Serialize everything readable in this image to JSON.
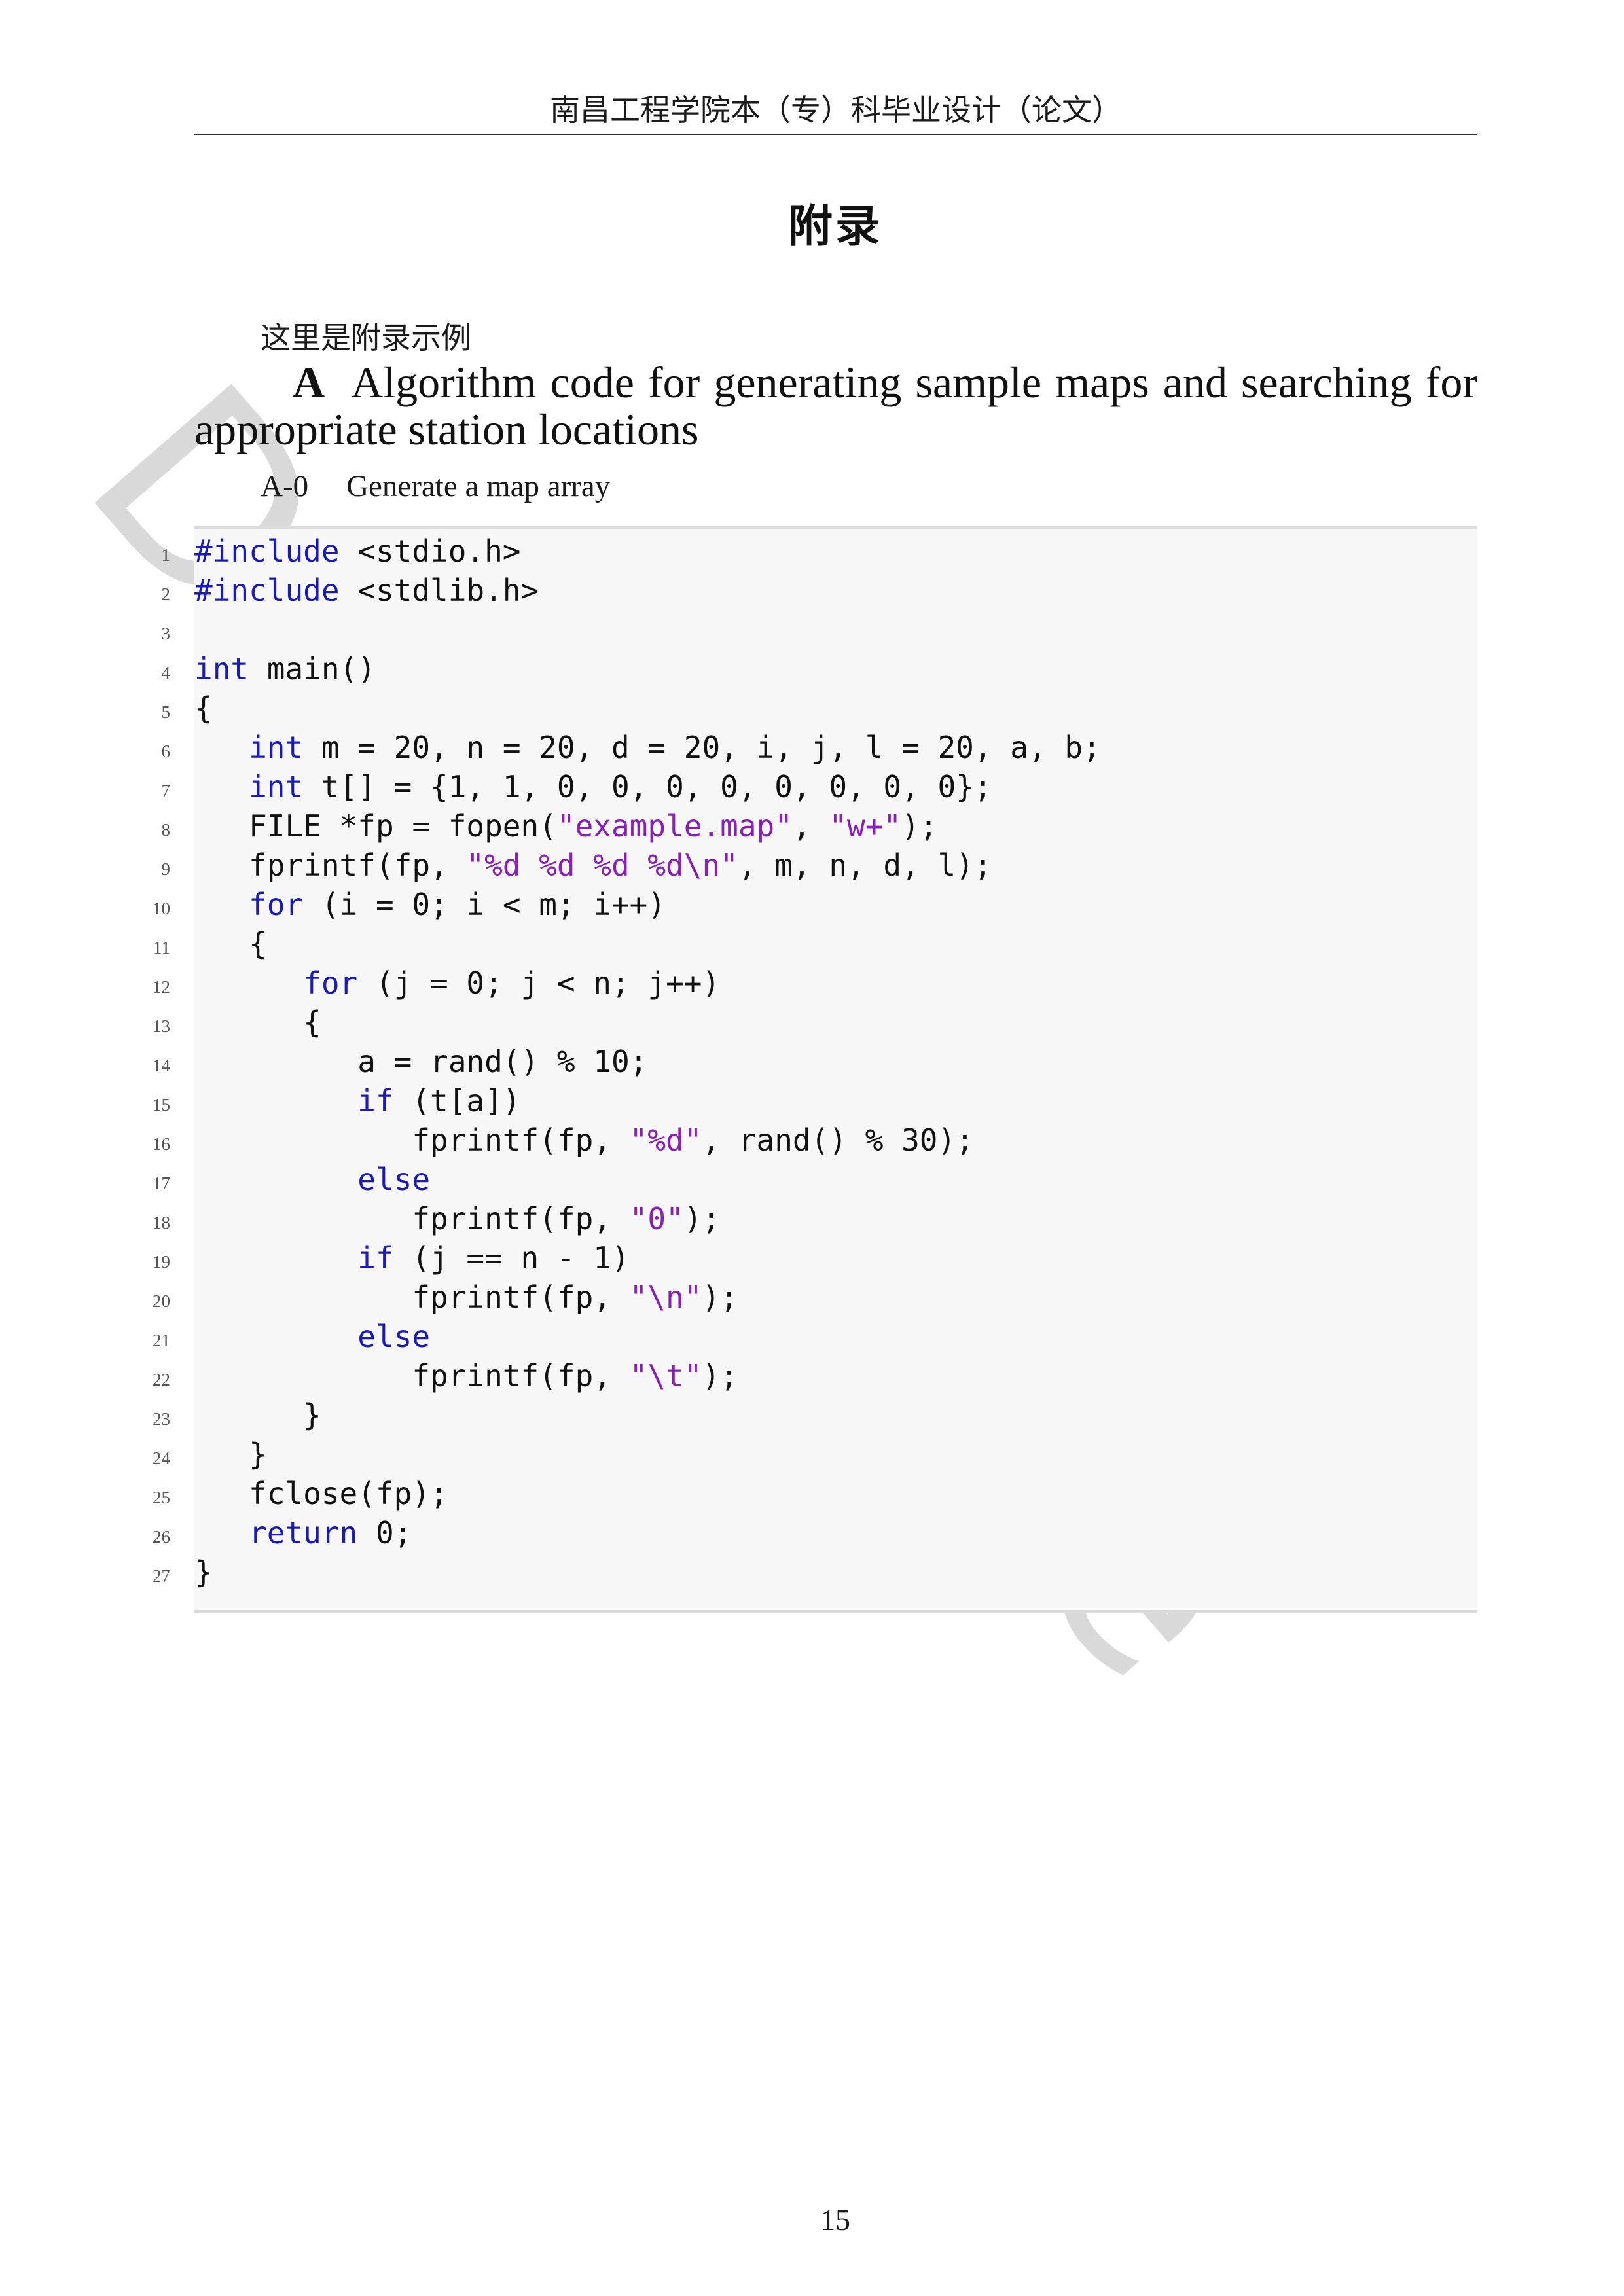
{
  "header": {
    "title": "南昌工程学院本（专）科毕业设计（论文）"
  },
  "appendix": {
    "title": "附录",
    "intro": "这里是附录示例",
    "section_letter": "A",
    "section_title": "Algorithm code for generating sample maps and searching for appropriate station locations",
    "subsection_number": "A-0",
    "subsection_title": "Generate a map array"
  },
  "code": {
    "lines": [
      {
        "num": "1",
        "segments": [
          {
            "t": "#include",
            "c": "kw"
          },
          {
            "t": " <stdio.h>",
            "c": ""
          }
        ]
      },
      {
        "num": "2",
        "segments": [
          {
            "t": "#include",
            "c": "kw"
          },
          {
            "t": " <stdlib.h>",
            "c": ""
          }
        ]
      },
      {
        "num": "3",
        "segments": []
      },
      {
        "num": "4",
        "segments": [
          {
            "t": "int",
            "c": "kw"
          },
          {
            "t": " main()",
            "c": ""
          }
        ]
      },
      {
        "num": "5",
        "segments": [
          {
            "t": "{",
            "c": ""
          }
        ]
      },
      {
        "num": "6",
        "segments": [
          {
            "t": "   ",
            "c": ""
          },
          {
            "t": "int",
            "c": "kw"
          },
          {
            "t": " m = 20, n = 20, d = 20, i, j, l = 20, a, b;",
            "c": ""
          }
        ]
      },
      {
        "num": "7",
        "segments": [
          {
            "t": "   ",
            "c": ""
          },
          {
            "t": "int",
            "c": "kw"
          },
          {
            "t": " t[] = {1, 1, 0, 0, 0, 0, 0, 0, 0, 0};",
            "c": ""
          }
        ]
      },
      {
        "num": "8",
        "segments": [
          {
            "t": "   FILE *fp = fopen(",
            "c": ""
          },
          {
            "t": "\"example.map\"",
            "c": "str"
          },
          {
            "t": ", ",
            "c": ""
          },
          {
            "t": "\"w+\"",
            "c": "str"
          },
          {
            "t": ");",
            "c": ""
          }
        ]
      },
      {
        "num": "9",
        "segments": [
          {
            "t": "   fprintf(fp, ",
            "c": ""
          },
          {
            "t": "\"%d %d %d %d\\n\"",
            "c": "str"
          },
          {
            "t": ", m, n, d, l);",
            "c": ""
          }
        ]
      },
      {
        "num": "10",
        "segments": [
          {
            "t": "   ",
            "c": ""
          },
          {
            "t": "for",
            "c": "kw"
          },
          {
            "t": " (i = 0; i < m; i++)",
            "c": ""
          }
        ]
      },
      {
        "num": "11",
        "segments": [
          {
            "t": "   {",
            "c": ""
          }
        ]
      },
      {
        "num": "12",
        "segments": [
          {
            "t": "      ",
            "c": ""
          },
          {
            "t": "for",
            "c": "kw"
          },
          {
            "t": " (j = 0; j < n; j++)",
            "c": ""
          }
        ]
      },
      {
        "num": "13",
        "segments": [
          {
            "t": "      {",
            "c": ""
          }
        ]
      },
      {
        "num": "14",
        "segments": [
          {
            "t": "         a = rand() % 10;",
            "c": ""
          }
        ]
      },
      {
        "num": "15",
        "segments": [
          {
            "t": "         ",
            "c": ""
          },
          {
            "t": "if",
            "c": "kw"
          },
          {
            "t": " (t[a])",
            "c": ""
          }
        ]
      },
      {
        "num": "16",
        "segments": [
          {
            "t": "            fprintf(fp, ",
            "c": ""
          },
          {
            "t": "\"%d\"",
            "c": "str"
          },
          {
            "t": ", rand() % 30);",
            "c": ""
          }
        ]
      },
      {
        "num": "17",
        "segments": [
          {
            "t": "         ",
            "c": ""
          },
          {
            "t": "else",
            "c": "kw"
          }
        ]
      },
      {
        "num": "18",
        "segments": [
          {
            "t": "            fprintf(fp, ",
            "c": ""
          },
          {
            "t": "\"0\"",
            "c": "str"
          },
          {
            "t": ");",
            "c": ""
          }
        ]
      },
      {
        "num": "19",
        "segments": [
          {
            "t": "         ",
            "c": ""
          },
          {
            "t": "if",
            "c": "kw"
          },
          {
            "t": " (j == n - 1)",
            "c": ""
          }
        ]
      },
      {
        "num": "20",
        "segments": [
          {
            "t": "            fprintf(fp, ",
            "c": ""
          },
          {
            "t": "\"\\n\"",
            "c": "str"
          },
          {
            "t": ");",
            "c": ""
          }
        ]
      },
      {
        "num": "21",
        "segments": [
          {
            "t": "         ",
            "c": ""
          },
          {
            "t": "else",
            "c": "kw"
          }
        ]
      },
      {
        "num": "22",
        "segments": [
          {
            "t": "            fprintf(fp, ",
            "c": ""
          },
          {
            "t": "\"\\t\"",
            "c": "str"
          },
          {
            "t": ");",
            "c": ""
          }
        ]
      },
      {
        "num": "23",
        "segments": [
          {
            "t": "      }",
            "c": ""
          }
        ]
      },
      {
        "num": "24",
        "segments": [
          {
            "t": "   }",
            "c": ""
          }
        ]
      },
      {
        "num": "25",
        "segments": [
          {
            "t": "   fclose(fp);",
            "c": ""
          }
        ]
      },
      {
        "num": "26",
        "segments": [
          {
            "t": "   ",
            "c": ""
          },
          {
            "t": "return",
            "c": "kw"
          },
          {
            "t": " 0;",
            "c": ""
          }
        ]
      },
      {
        "num": "27",
        "segments": [
          {
            "t": "}",
            "c": ""
          }
        ]
      }
    ]
  },
  "watermark": {
    "text": "DRAFT Rice",
    "color": "#dcdcdc"
  },
  "colors": {
    "keyword": "#1a1ab8",
    "string": "#8a1fb5",
    "code_background": "#f7f7f7"
  },
  "footer": {
    "page_number": "15"
  }
}
